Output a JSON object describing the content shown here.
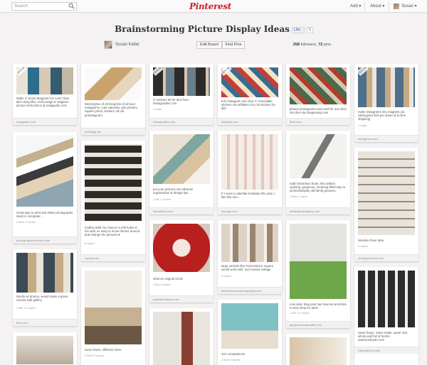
{
  "topbar": {
    "search_placeholder": "Search",
    "logo": "Pinterest",
    "nav": {
      "add": "Add ▾",
      "about": "About ▾",
      "user": "Susan ▾"
    }
  },
  "board": {
    "title": "Brainstorming Picture Display Ideas",
    "like_label": "Like",
    "like_count": "1",
    "owner": "Susan Keller",
    "edit_board": "Edit Board",
    "find_pins": "Find Pins",
    "followers": "258",
    "followers_label": "followers,",
    "pins": "72",
    "pins_label": "pins"
  },
  "colors": {
    "brand": "#cb2027",
    "background": "#f4f2f2",
    "card": "#ffffff"
  },
  "pins": [
    {
      "id": "p1",
      "price": "$15.00",
      "desc": "Make 2\" photo Magnets For Less Than $10 using tiles, mod podge & magnets - picture instructions at snapguide.com",
      "stat": "",
      "src": "snapguide.com"
    },
    {
      "id": "p2",
      "price": "",
      "desc": "Memorybox of all minprints of all your instagrams. cute calendar, grid posters, square prints, stickers, all via printstagr.am",
      "stat": "",
      "src": "printstagr.am"
    },
    {
      "id": "p3",
      "price": "$14.00",
      "desc": "1\" stickers 90 for $14 from instagoodies.com",
      "stat": "1 repin",
      "src": "instagoodies.com"
    },
    {
      "id": "p4",
      "price": "$21.00",
      "desc": "turn instagram into vinyl 4\" removable stickers via artflakes.com 10 stickers for $21",
      "stat": "",
      "src": "artflakes.com"
    },
    {
      "id": "p5",
      "price": "",
      "desc": "photos (instagrams work well for 2x2 size) into tiles via imageanap.com",
      "stat": "",
      "src": "flickr.com"
    },
    {
      "id": "p6",
      "price": "$15.00",
      "desc": "make instagrams into magnets via Stickygram $15 per sheet of 9 (free shipping)",
      "stat": "1 repin",
      "src": "stickygram.com"
    },
    {
      "id": "p7",
      "price": "",
      "desc": "Great way to print and share photographs stack in computer...",
      "stat": "2 likes   3 repins",
      "src": "photographersbookkit.com"
    },
    {
      "id": "p8",
      "price": "",
      "desc": "Gallery Wall. No reason to drill holes in the wall, so easy to move frames around and change the pictures ♥",
      "stat": "6 repins",
      "src": "repinly.com"
    },
    {
      "id": "p9",
      "price": "",
      "desc": "put your pictures into albums! organization & design tips ...",
      "stat": "1 like   2 repins",
      "src": "iheartfaces.com"
    },
    {
      "id": "p10",
      "price": "",
      "desc": "If I need a calendar template this year, I like this one...",
      "stat": "",
      "src": "oscraps.com"
    },
    {
      "id": "p11",
      "price": "",
      "desc": "todd richardson book, thru artifact uprising. gorgeous, meaning-filled way to archive/display old family pictures.",
      "stat": "2 likes   1 repin",
      "src": "artifactuprisingblog.com"
    },
    {
      "id": "p12",
      "price": "",
      "desc": "Window Pane Idea",
      "stat": "9 repins",
      "src": "photogmommie.com"
    },
    {
      "id": "p13",
      "price": "",
      "desc": "Words w/ photos, would make a great canvas wall gallery",
      "stat": "1 like   12 repins",
      "src": "flickr.com"
    },
    {
      "id": "p14",
      "price": "",
      "desc": "same frame, different sizes",
      "stat": "2 likes   6 repins",
      "src": ""
    },
    {
      "id": "p15",
      "price": "",
      "desc": "what an original clock!",
      "stat": "1 like   3 repins",
      "src": "paperieboutique.com"
    },
    {
      "id": "p16",
      "price": "",
      "desc": "large vertical (thin horizontal or square would work well, too) canvas collage",
      "stat": "2 repins",
      "src": "laurasimonsonphotography.com"
    },
    {
      "id": "p17",
      "price": "",
      "desc": "cute idea: blog post has how-tos and links to etsy shop for parts",
      "stat": "1 like   22 repins",
      "src": "gingerandsnapcrafts.com"
    },
    {
      "id": "p18",
      "price": "",
      "desc": "same frame, same matte, same size, whole wall full of 5x10s - www.lenahyde.com",
      "stat": "",
      "src": "Uploaded by user"
    },
    {
      "id": "p19",
      "price": "",
      "desc": "size comparisons",
      "stat": "2 likes   9 repins",
      "src": ""
    }
  ]
}
